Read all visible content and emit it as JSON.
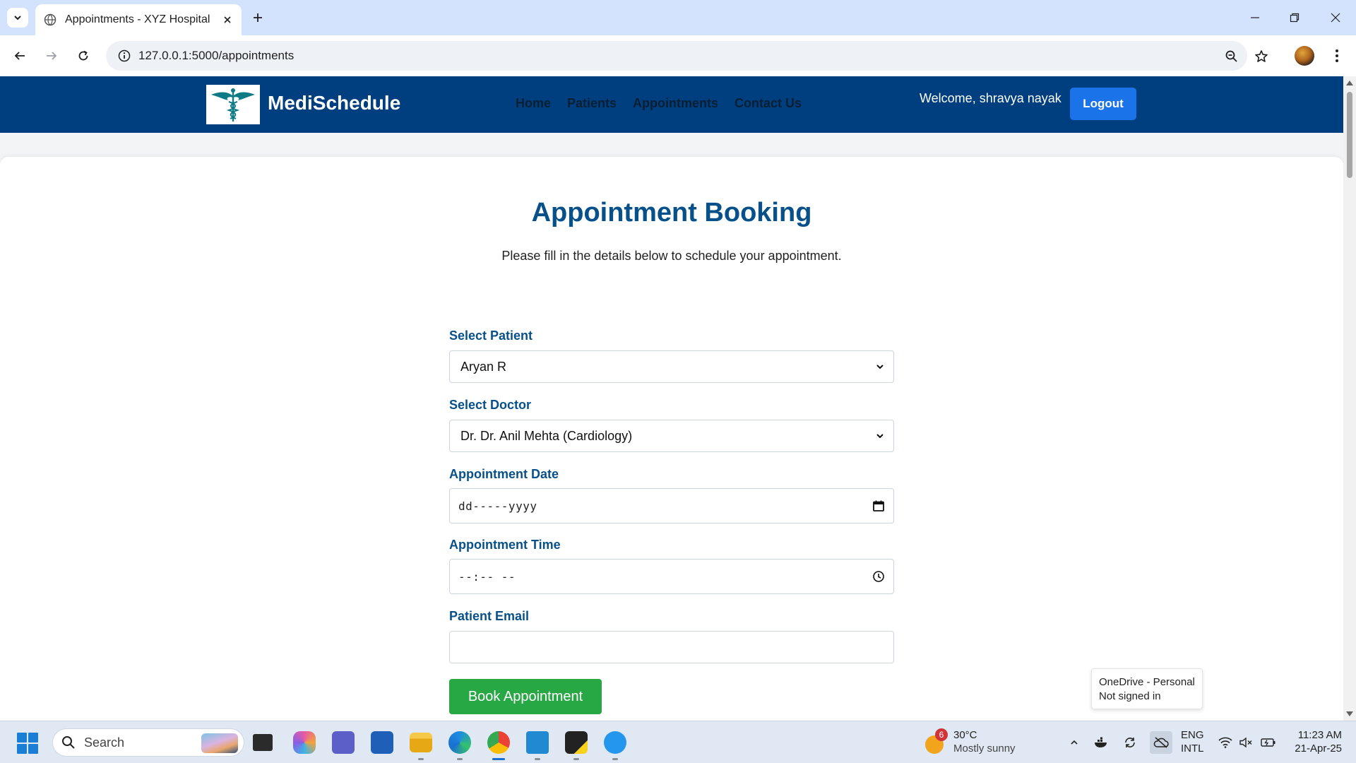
{
  "browser": {
    "tab_title": "Appointments - XYZ Hospital",
    "url": "127.0.0.1:5000/appointments"
  },
  "site": {
    "brand": "MediSchedule",
    "nav": [
      "Home",
      "Patients",
      "Appointments",
      "Contact Us"
    ],
    "welcome": "Welcome, shravya nayak",
    "logout_label": "Logout"
  },
  "main": {
    "title": "Appointment Booking",
    "subtitle": "Please fill in the details below to schedule your appointment."
  },
  "form": {
    "patient_label": "Select Patient",
    "patient_value": "Aryan R",
    "doctor_label": "Select Doctor",
    "doctor_value": "Dr. Dr. Anil Mehta (Cardiology)",
    "date_label": "Appointment Date",
    "date_placeholder": "dd-----yyyy",
    "time_label": "Appointment Time",
    "time_placeholder": "--:-- --",
    "email_label": "Patient Email",
    "email_value": "",
    "submit_label": "Book Appointment"
  },
  "toast": {
    "line1": "OneDrive - Personal",
    "line2": "Not signed in"
  },
  "taskbar": {
    "search_placeholder": "Search",
    "weather_badge": "6",
    "weather_temp": "30°C",
    "weather_cond": "Mostly sunny",
    "lang_top": "ENG",
    "lang_bottom": "INTL",
    "time": "11:23 AM",
    "date": "21-Apr-25"
  },
  "colors": {
    "header_bg": "#003f7f",
    "title": "#07508a",
    "logout_bg": "#1a73e8",
    "book_bg": "#28a745"
  }
}
